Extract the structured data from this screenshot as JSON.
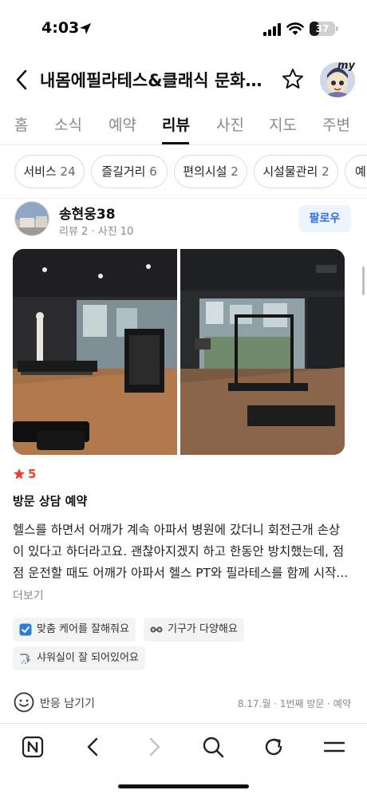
{
  "status_bar": {
    "time": "4:03",
    "battery": "37",
    "battery_fraction": 0.37
  },
  "header": {
    "title": "내몸에필라테스&클래식 문화센터",
    "badge": "my"
  },
  "tabs": [
    {
      "label": "홈"
    },
    {
      "label": "소식"
    },
    {
      "label": "예약"
    },
    {
      "label": "리뷰",
      "active": true
    },
    {
      "label": "사진"
    },
    {
      "label": "지도"
    },
    {
      "label": "주변"
    }
  ],
  "filters": [
    {
      "label": "서비스",
      "count": "24"
    },
    {
      "label": "즐길거리",
      "count": "6"
    },
    {
      "label": "편의시설",
      "count": "2"
    },
    {
      "label": "시설물관리",
      "count": "2"
    },
    {
      "label": "예",
      "count": ""
    }
  ],
  "review": {
    "author": "송현웅38",
    "meta": "리뷰 2 · 사진 10",
    "follow_label": "팔로우",
    "rating": "5",
    "visit_type": "방문 상담 예약",
    "text_lines": [
      "헬스를 하면서 어깨가 계속 아파서 병원에 갔더니 회전근개 손상",
      "이 있다고 하더라고요. 괜찮아지겠지 하고 한동안 방치했는데, 점",
      "점 운전할 때도 어깨가 아파서 헬스 PT와 필라테스를 함께 시작..."
    ],
    "more_label": "더보기",
    "tags": [
      {
        "label": "맞춤 케어를 잘해줘요",
        "icon": "check-box-icon"
      },
      {
        "label": "기구가 다양해요",
        "icon": "equipment-icon"
      },
      {
        "label": "샤워실이 잘 되어있어요",
        "icon": "shower-icon"
      }
    ],
    "reaction_label": "반응 남기기",
    "visit_meta": "8.17.월 · 1번째 방문 · 예약"
  },
  "colors": {
    "accent_blue": "#2f6fe8",
    "rating_red": "#e8432d"
  }
}
